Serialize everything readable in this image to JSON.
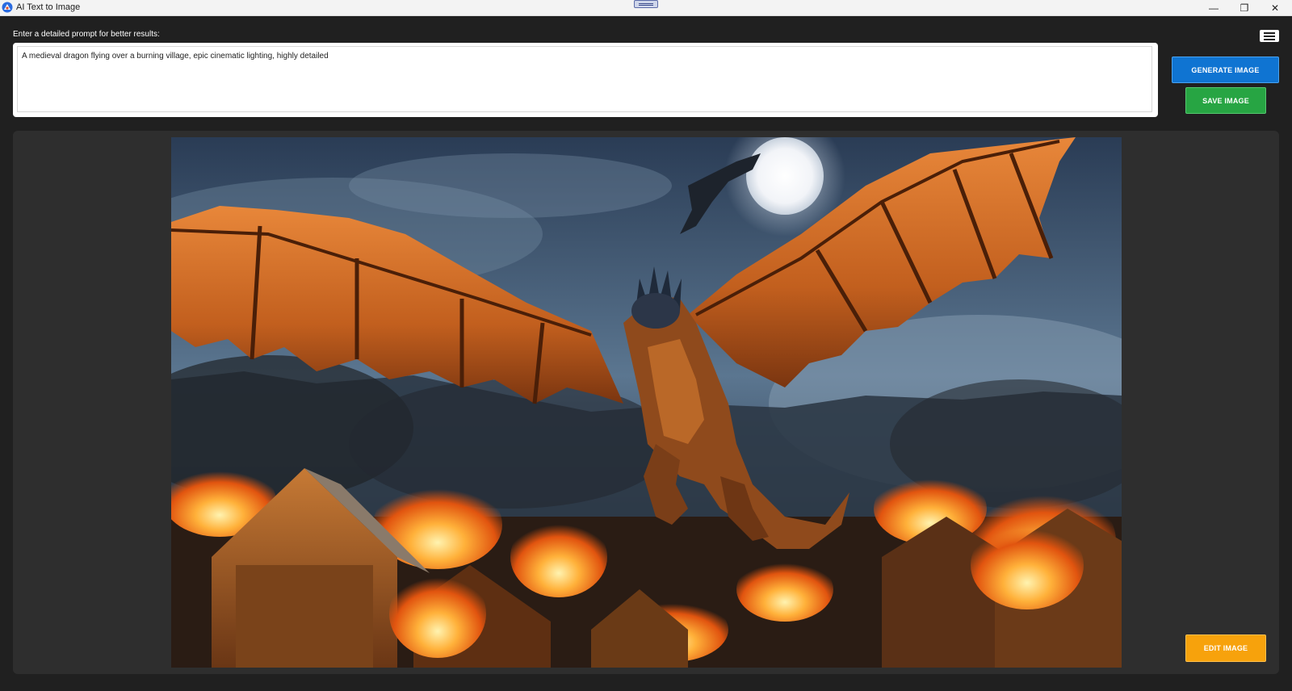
{
  "window": {
    "title": "AI Text to Image",
    "minimize_glyph": "—",
    "maximize_glyph": "❐",
    "close_glyph": "✕"
  },
  "prompt": {
    "label": "Enter a detailed prompt for better results:",
    "value": "A medieval dragon flying over a burning village, epic cinematic lighting, highly detailed"
  },
  "buttons": {
    "generate": "GENERATE IMAGE",
    "save": "SAVE IMAGE",
    "edit": "EDIT IMAGE"
  },
  "icons": {
    "app": "app-logo-icon",
    "menu": "hamburger-menu-icon",
    "drag": "drag-handle-icon"
  },
  "colors": {
    "background": "#202020",
    "panel": "#2e2e2e",
    "generate": "#0f74d2",
    "save": "#27a543",
    "edit": "#f7a20c"
  },
  "image": {
    "subject": "generated-image"
  }
}
